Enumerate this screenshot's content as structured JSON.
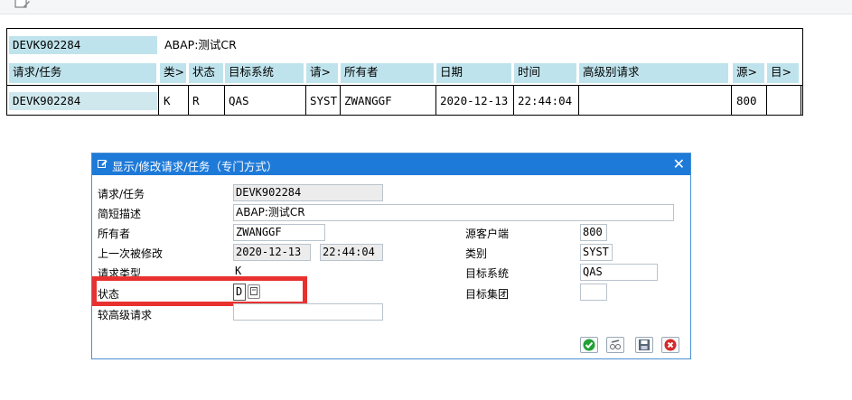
{
  "list": {
    "request_id": "DEVK902284",
    "description": "ABAP:测试CR",
    "headers": [
      "请求/任务",
      "类>",
      "状态",
      "目标系统",
      "请>",
      "所有者",
      "日期",
      "时间",
      "高级别请求",
      "源>",
      "目>"
    ],
    "row": [
      "DEVK902284",
      "K",
      "R",
      "QAS",
      "SYST",
      "ZWANGGF",
      "2020-12-13",
      "22:44:04",
      "",
      "800",
      ""
    ]
  },
  "dialog": {
    "title": "显示/修改请求/任务（专门方式）",
    "labels": {
      "request_task": "请求/任务",
      "short_desc": "简短描述",
      "owner": "所有者",
      "last_changed": "上一次被修改",
      "request_type": "请求类型",
      "status": "状态",
      "higher_request": "较高级请求",
      "source_client": "源客户端",
      "category": "类别",
      "target_system": "目标系统",
      "target_group": "目标集团"
    },
    "values": {
      "request_task": "DEVK902284",
      "short_desc": "ABAP:测试CR",
      "owner": "ZWANGGF",
      "last_changed_date": "2020-12-13",
      "last_changed_time": "22:44:04",
      "request_type": "K",
      "status": "D",
      "higher_request": "",
      "source_client": "800",
      "category": "SYST",
      "target_system": "QAS",
      "target_group": ""
    }
  },
  "colors": {
    "title_bar": "#1e7ad8",
    "header_cell": "#bfe3ec",
    "highlight": "#e8312f"
  }
}
